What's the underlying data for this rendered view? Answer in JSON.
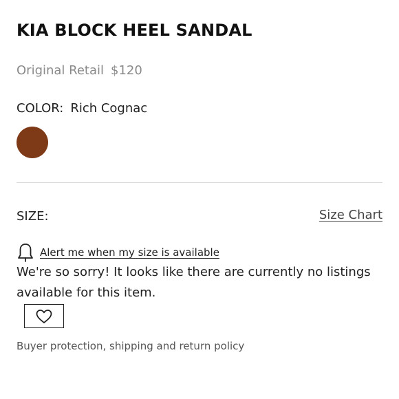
{
  "product": {
    "title": "KIA BLOCK HEEL SANDAL",
    "original_retail_label": "Original Retail",
    "original_retail_price": "$120"
  },
  "color": {
    "label": "COLOR:",
    "value": "Rich Cognac",
    "swatch_hex": "#7e3a17"
  },
  "size": {
    "label": "SIZE:",
    "size_chart_link": "Size Chart"
  },
  "alert": {
    "icon": "bell-icon",
    "link_text": "Alert me when my size is available"
  },
  "message": {
    "no_listings": "We're so sorry! It looks like there are currently no listings available for this item."
  },
  "favorite": {
    "icon": "heart-icon"
  },
  "footer": {
    "policy_link": "Buyer protection, shipping and return policy"
  }
}
